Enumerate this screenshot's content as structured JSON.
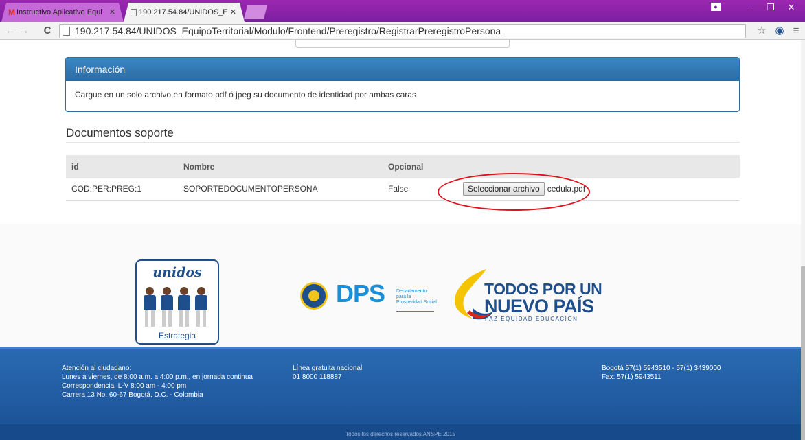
{
  "browser": {
    "tabs": [
      {
        "title": "Instructivo Aplicativo Equi",
        "favicon": "M"
      },
      {
        "title": "190.217.54.84/UNIDOS_Eq",
        "favicon": ""
      }
    ],
    "url": "190.217.54.84/UNIDOS_EquipoTerritorial/Modulo/Frontend/Preregistro/RegistrarPreregistroPersona",
    "accent_color": "#8e24aa"
  },
  "info_panel": {
    "heading": "Información",
    "body": "Cargue en un solo archivo en formato pdf ó jpeg su documento de identidad por ambas caras"
  },
  "documents": {
    "title": "Documentos soporte",
    "columns": [
      "id",
      "Nombre",
      "Opcional"
    ],
    "rows": [
      {
        "id": "COD:PER:PREG:1",
        "nombre": "SOPORTEDOCUMENTOPERSONA",
        "opcional": "False",
        "button_label": "Seleccionar archivo",
        "file_name": "cedula.pdf"
      }
    ]
  },
  "logos": {
    "unidos": {
      "title": "unidos",
      "subtitle": "Estrategia"
    },
    "dps": {
      "text": "DPS",
      "subtitle": "Departamento para la Prosperidad Social"
    },
    "gobierno": {
      "line1": "TODOS POR UN",
      "line2": "NUEVO PAÍS",
      "line3": "PAZ  EQUIDAD  EDUCACIÓN"
    }
  },
  "footer": {
    "col1": [
      "Atención al ciudadano:",
      "Lunes a viernes, de 8:00 a.m. a 4:00 p.m., en jornada continua",
      "Correspondencia: L-V 8:00 am - 4:00 pm",
      "Carrera 13 No. 60-67 Bogotá, D.C. - Colombia"
    ],
    "col2": [
      "Línea gratuita nacional",
      "01 8000 118887"
    ],
    "col3": [
      "Bogotá 57(1) 5943510 - 57(1) 3439000",
      "Fax: 57(1) 5943511"
    ],
    "copyright": "Todos los derechos reservados ANSPE 2015"
  }
}
